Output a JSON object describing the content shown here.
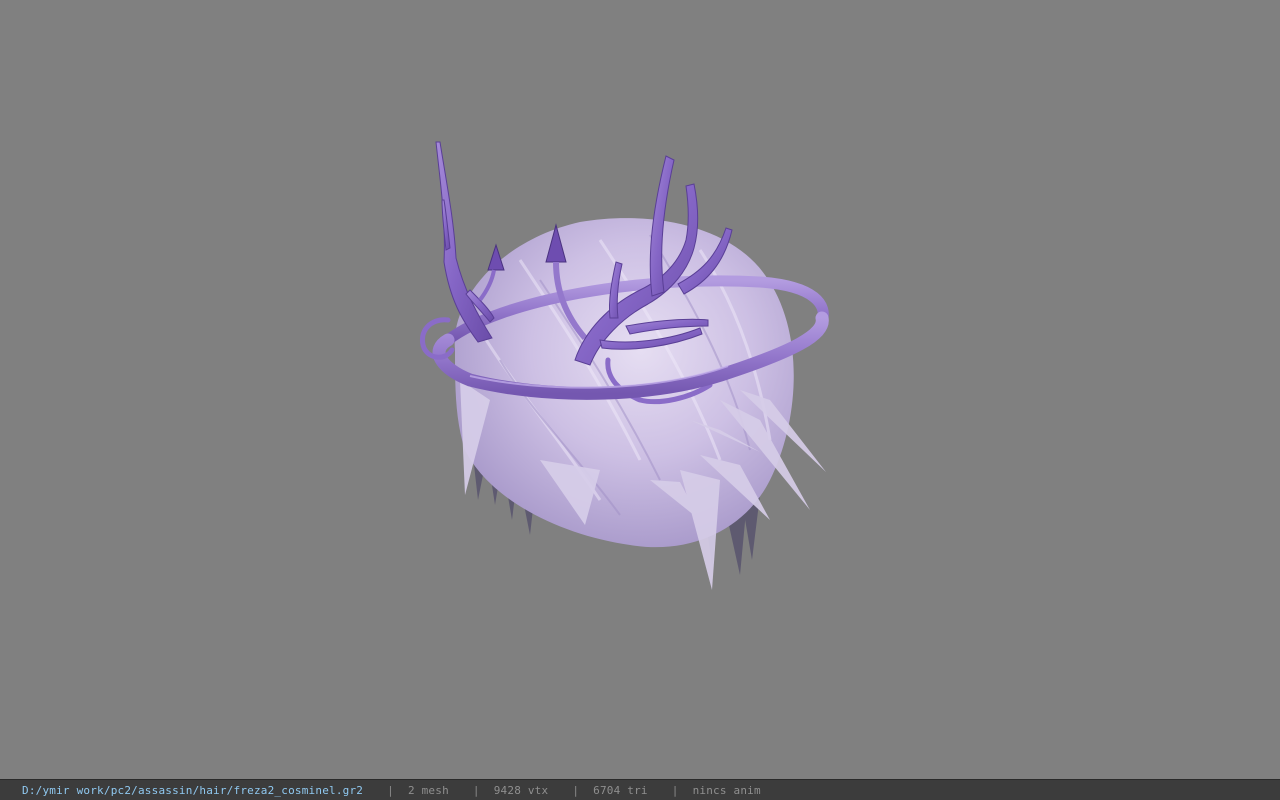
{
  "viewport": {
    "background": "#808080",
    "model_name": "freza2_cosminel"
  },
  "status_bar": {
    "file_path": "D:/ymir work/pc2/assassin/hair/freza2_cosminel.gr2",
    "separator": "|",
    "mesh_count": "2 mesh",
    "vertex_count": "9428 vtx",
    "triangle_count": "6704 tri",
    "anim_status": "nincs anim"
  },
  "colors": {
    "hair_light": "#d8cfe8",
    "hair_mid": "#b8aad6",
    "hair_dark": "#6e6a82",
    "antler": "#8a6cc8",
    "antler_dark": "#5a3f96",
    "path_text": "#8fc8f0",
    "stat_text": "#8f8f8f",
    "status_bg": "#3c3c3c"
  }
}
